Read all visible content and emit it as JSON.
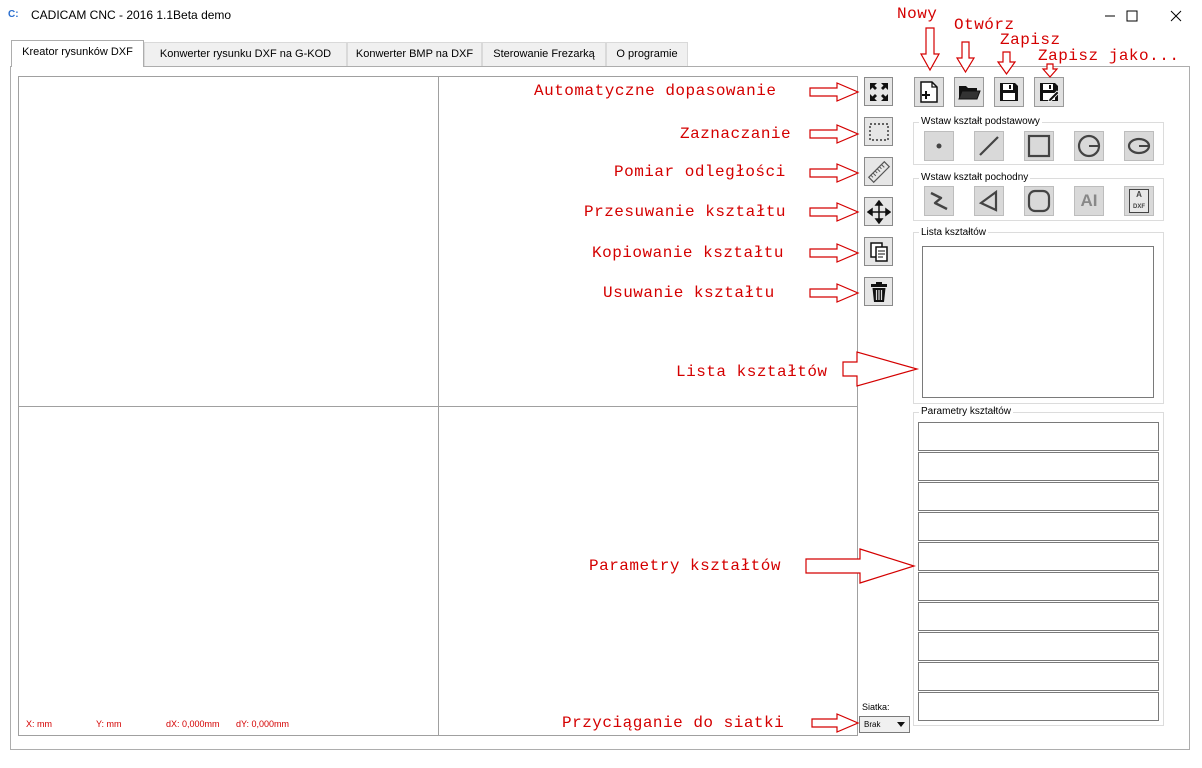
{
  "window": {
    "title": "CADICAM CNC - 2016 1.1Beta demo",
    "icon": "cadicam-logo-icon",
    "icon_text": "C:"
  },
  "tabs": [
    {
      "label": "Kreator rysunków DXF",
      "active": true
    },
    {
      "label": "Konwerter rysunku DXF na G-KOD",
      "active": false
    },
    {
      "label": "Konwerter BMP na DXF",
      "active": false
    },
    {
      "label": "Sterowanie Frezarką",
      "active": false
    },
    {
      "label": "O programie",
      "active": false
    }
  ],
  "status": {
    "x": "X: mm",
    "y": "Y: mm",
    "dx": "dX: 0,000mm",
    "dy": "dY: 0,000mm"
  },
  "tools": [
    {
      "icon": "fit-expand-icon"
    },
    {
      "icon": "selection-rect-icon"
    },
    {
      "icon": "ruler-icon"
    },
    {
      "icon": "move-arrows-icon"
    },
    {
      "icon": "copy-icon"
    },
    {
      "icon": "trash-icon"
    }
  ],
  "annotations": {
    "nowy": "Nowy",
    "otworz": "Otwórz",
    "zapisz": "Zapisz",
    "zapisz_jako": "Zapisz jako...",
    "auto_fit": "Automatyczne dopasowanie",
    "select": "Zaznaczanie",
    "measure": "Pomiar odległości",
    "move": "Przesuwanie kształtu",
    "copy": "Kopiowanie kształtu",
    "delete": "Usuwanie kształtu",
    "shape_list": "Lista kształtów",
    "shape_params": "Parametry kształtów",
    "snap": "Przyciąganie do siatki"
  },
  "file_buttons": [
    {
      "icon": "new-file-icon"
    },
    {
      "icon": "open-folder-icon"
    },
    {
      "icon": "save-icon"
    },
    {
      "icon": "save-as-icon"
    }
  ],
  "groups": {
    "basic_shapes": "Wstaw kształt podstawowy",
    "derived_shapes": "Wstaw kształt pochodny",
    "shape_list": "Lista kształtów",
    "shape_params": "Parametry kształtów"
  },
  "basic_shape_icons": [
    "point-icon",
    "line-icon",
    "rectangle-icon",
    "circle-icon",
    "ellipse-icon"
  ],
  "derived_shape_icons": [
    "polyline-icon",
    "polygon-icon",
    "rounded-rect-icon",
    "text-icon",
    "dxf-import-icon"
  ],
  "derived_text_glyph": "AI",
  "dxf_glyph": "DXF",
  "grid": {
    "label": "Siatka:",
    "value": "Brak"
  },
  "colors": {
    "annotation": "#d40000",
    "panel_border": "#a0a0a0"
  }
}
